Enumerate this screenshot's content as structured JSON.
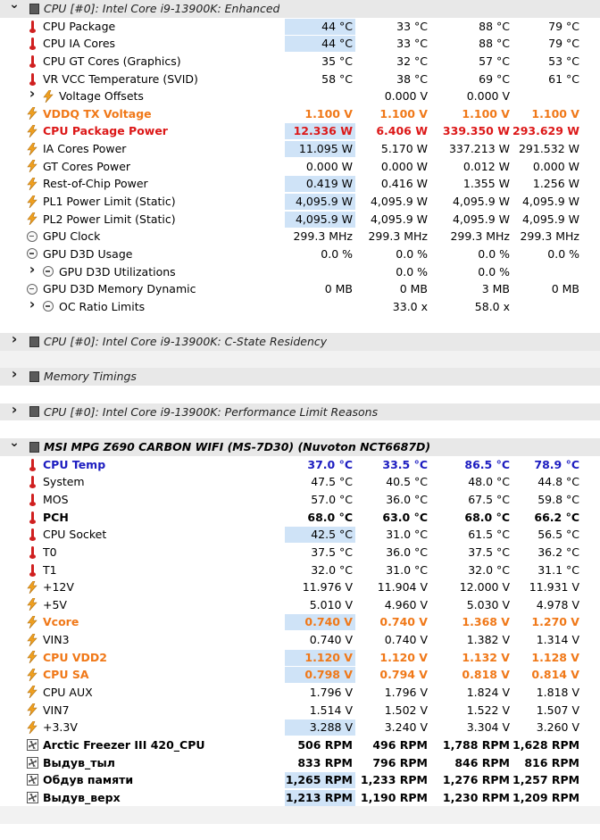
{
  "rows": [
    {
      "type": "group",
      "expanded": true,
      "indent": 0,
      "icon": "chip-icon",
      "label": "CPU [#0]: Intel Core i9-13900K: Enhanced"
    },
    {
      "type": "sensor",
      "icon": "thermometer-icon",
      "label": "CPU Package",
      "values": [
        "44 °C",
        "33 °C",
        "88 °C",
        "79 °C"
      ],
      "hl": true
    },
    {
      "type": "sensor",
      "icon": "thermometer-icon",
      "label": "CPU IA Cores",
      "values": [
        "44 °C",
        "33 °C",
        "88 °C",
        "79 °C"
      ],
      "hl": true
    },
    {
      "type": "sensor",
      "icon": "thermometer-icon",
      "label": "CPU GT Cores (Graphics)",
      "values": [
        "35 °C",
        "32 °C",
        "57 °C",
        "53 °C"
      ]
    },
    {
      "type": "sensor",
      "icon": "thermometer-icon",
      "label": "VR VCC Temperature (SVID)",
      "values": [
        "58 °C",
        "38 °C",
        "69 °C",
        "61 °C"
      ]
    },
    {
      "type": "sensor",
      "collapsed": true,
      "icon": "bolt-icon",
      "label": "Voltage Offsets",
      "values": [
        "",
        "0.000 V",
        "0.000 V",
        ""
      ]
    },
    {
      "type": "sensor",
      "icon": "bolt-icon",
      "label": "VDDQ TX Voltage",
      "values": [
        "1.100 V",
        "1.100 V",
        "1.100 V",
        "1.100 V"
      ],
      "style": "orange",
      "bold": true
    },
    {
      "type": "sensor",
      "icon": "bolt-icon",
      "label": "CPU Package Power",
      "values": [
        "12.336 W",
        "6.406 W",
        "339.350 W",
        "293.629 W"
      ],
      "style": "red",
      "bold": true,
      "hl": true
    },
    {
      "type": "sensor",
      "icon": "bolt-icon",
      "label": "IA Cores Power",
      "values": [
        "11.095 W",
        "5.170 W",
        "337.213 W",
        "291.532 W"
      ],
      "hl": true
    },
    {
      "type": "sensor",
      "icon": "bolt-icon",
      "label": "GT Cores Power",
      "values": [
        "0.000 W",
        "0.000 W",
        "0.012 W",
        "0.000 W"
      ]
    },
    {
      "type": "sensor",
      "icon": "bolt-icon",
      "label": "Rest-of-Chip Power",
      "values": [
        "0.419 W",
        "0.416 W",
        "1.355 W",
        "1.256 W"
      ],
      "hl": true
    },
    {
      "type": "sensor",
      "icon": "bolt-icon",
      "label": "PL1 Power Limit (Static)",
      "values": [
        "4,095.9 W",
        "4,095.9 W",
        "4,095.9 W",
        "4,095.9 W"
      ],
      "hl": true
    },
    {
      "type": "sensor",
      "icon": "bolt-icon",
      "label": "PL2 Power Limit (Static)",
      "values": [
        "4,095.9 W",
        "4,095.9 W",
        "4,095.9 W",
        "4,095.9 W"
      ],
      "hl": true
    },
    {
      "type": "sensor",
      "icon": "gauge-icon",
      "label": "GPU Clock",
      "values": [
        "299.3 MHz",
        "299.3 MHz",
        "299.3 MHz",
        "299.3 MHz"
      ]
    },
    {
      "type": "sensor",
      "icon": "gauge-icon",
      "label": "GPU D3D Usage",
      "values": [
        "0.0 %",
        "0.0 %",
        "0.0 %",
        "0.0 %"
      ]
    },
    {
      "type": "sensor",
      "collapsed": true,
      "icon": "gauge-icon",
      "label": "GPU D3D Utilizations",
      "values": [
        "",
        "0.0 %",
        "0.0 %",
        ""
      ]
    },
    {
      "type": "sensor",
      "icon": "gauge-icon",
      "label": "GPU D3D Memory Dynamic",
      "values": [
        "0 MB",
        "0 MB",
        "3 MB",
        "0 MB"
      ]
    },
    {
      "type": "sensor",
      "collapsed": true,
      "icon": "gauge-icon",
      "label": "OC Ratio Limits",
      "values": [
        "",
        "33.0 x",
        "58.0 x",
        ""
      ]
    },
    {
      "type": "gap"
    },
    {
      "type": "group",
      "expanded": false,
      "icon": "chip-icon",
      "label": "CPU [#0]: Intel Core i9-13900K: C-State Residency"
    },
    {
      "type": "gapfill"
    },
    {
      "type": "group",
      "expanded": false,
      "icon": "chip-icon",
      "label": "Memory Timings"
    },
    {
      "type": "gap"
    },
    {
      "type": "group",
      "expanded": false,
      "icon": "chip-icon",
      "label": "CPU [#0]: Intel Core i9-13900K: Performance Limit Reasons"
    },
    {
      "type": "gap"
    },
    {
      "type": "group",
      "expanded": true,
      "icon": "chip-icon",
      "label": "MSI MPG Z690 CARBON WIFI (MS-7D30) (Nuvoton NCT6687D)",
      "bold": true
    },
    {
      "type": "sensor",
      "icon": "thermometer-icon",
      "label": "CPU Temp",
      "values": [
        "37.0 °C",
        "33.5 °C",
        "86.5 °C",
        "78.9 °C"
      ],
      "style": "blue",
      "bold": true
    },
    {
      "type": "sensor",
      "icon": "thermometer-icon",
      "label": "System",
      "values": [
        "47.5 °C",
        "40.5 °C",
        "48.0 °C",
        "44.8 °C"
      ]
    },
    {
      "type": "sensor",
      "icon": "thermometer-icon",
      "label": "MOS",
      "values": [
        "57.0 °C",
        "36.0 °C",
        "67.5 °C",
        "59.8 °C"
      ]
    },
    {
      "type": "sensor",
      "icon": "thermometer-icon",
      "label": "PCH",
      "values": [
        "68.0 °C",
        "63.0 °C",
        "68.0 °C",
        "66.2 °C"
      ],
      "bold": true
    },
    {
      "type": "sensor",
      "icon": "thermometer-icon",
      "label": "CPU Socket",
      "values": [
        "42.5 °C",
        "31.0 °C",
        "61.5 °C",
        "56.5 °C"
      ],
      "hl": true
    },
    {
      "type": "sensor",
      "icon": "thermometer-icon",
      "label": "T0",
      "values": [
        "37.5 °C",
        "36.0 °C",
        "37.5 °C",
        "36.2 °C"
      ]
    },
    {
      "type": "sensor",
      "icon": "thermometer-icon",
      "label": "T1",
      "values": [
        "32.0 °C",
        "31.0 °C",
        "32.0 °C",
        "31.1 °C"
      ]
    },
    {
      "type": "sensor",
      "icon": "bolt-icon",
      "label": "+12V",
      "values": [
        "11.976 V",
        "11.904 V",
        "12.000 V",
        "11.931 V"
      ]
    },
    {
      "type": "sensor",
      "icon": "bolt-icon",
      "label": "+5V",
      "values": [
        "5.010 V",
        "4.960 V",
        "5.030 V",
        "4.978 V"
      ]
    },
    {
      "type": "sensor",
      "icon": "bolt-icon",
      "label": "Vcore",
      "values": [
        "0.740 V",
        "0.740 V",
        "1.368 V",
        "1.270 V"
      ],
      "style": "orange",
      "bold": true,
      "hl": true
    },
    {
      "type": "sensor",
      "icon": "bolt-icon",
      "label": "VIN3",
      "values": [
        "0.740 V",
        "0.740 V",
        "1.382 V",
        "1.314 V"
      ]
    },
    {
      "type": "sensor",
      "icon": "bolt-icon",
      "label": "CPU VDD2",
      "values": [
        "1.120 V",
        "1.120 V",
        "1.132 V",
        "1.128 V"
      ],
      "style": "orange",
      "bold": true,
      "hl": true
    },
    {
      "type": "sensor",
      "icon": "bolt-icon",
      "label": "CPU SA",
      "values": [
        "0.798 V",
        "0.794 V",
        "0.818 V",
        "0.814 V"
      ],
      "style": "orange",
      "bold": true,
      "hl": true
    },
    {
      "type": "sensor",
      "icon": "bolt-icon",
      "label": "CPU AUX",
      "values": [
        "1.796 V",
        "1.796 V",
        "1.824 V",
        "1.818 V"
      ]
    },
    {
      "type": "sensor",
      "icon": "bolt-icon",
      "label": "VIN7",
      "values": [
        "1.514 V",
        "1.502 V",
        "1.522 V",
        "1.507 V"
      ]
    },
    {
      "type": "sensor",
      "icon": "bolt-icon",
      "label": "+3.3V",
      "values": [
        "3.288 V",
        "3.240 V",
        "3.304 V",
        "3.260 V"
      ],
      "hl": true
    },
    {
      "type": "sensor",
      "icon": "fan-icon",
      "label": "Arctic Freezer III 420_CPU",
      "values": [
        "506 RPM",
        "496 RPM",
        "1,788 RPM",
        "1,628 RPM"
      ],
      "bold": true
    },
    {
      "type": "sensor",
      "icon": "fan-icon",
      "label": "Выдув_тыл",
      "values": [
        "833 RPM",
        "796 RPM",
        "846 RPM",
        "816 RPM"
      ],
      "bold": true
    },
    {
      "type": "sensor",
      "icon": "fan-icon",
      "label": "Обдув памяти",
      "values": [
        "1,265 RPM",
        "1,233 RPM",
        "1,276 RPM",
        "1,257 RPM"
      ],
      "bold": true,
      "hl": true
    },
    {
      "type": "sensor",
      "icon": "fan-icon",
      "label": "Выдув_верх",
      "values": [
        "1,213 RPM",
        "1,190 RPM",
        "1,230 RPM",
        "1,209 RPM"
      ],
      "bold": true,
      "hl": true
    },
    {
      "type": "gapfill"
    }
  ],
  "colors": {
    "highlight": "#cfe3f7",
    "orange": "#f07818",
    "red": "#dc1818",
    "blue": "#1c1cc0",
    "group_bg": "#e8e8e8"
  }
}
